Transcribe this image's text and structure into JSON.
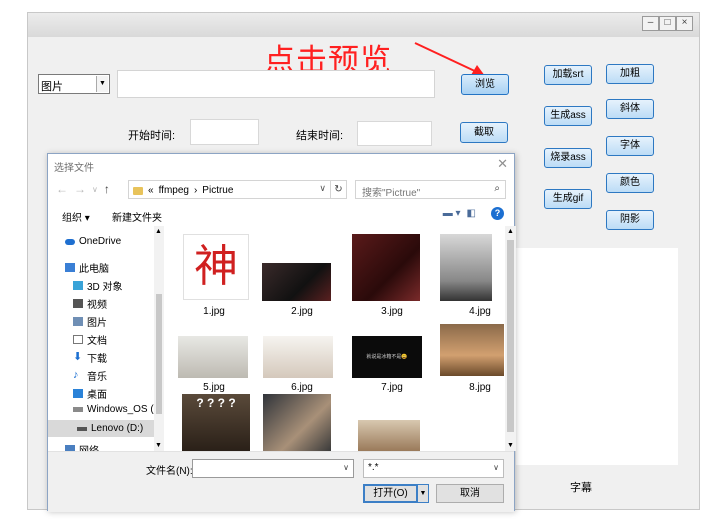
{
  "app": {
    "window_buttons": [
      "–",
      "□",
      "×"
    ],
    "annotation_text": "点击预览",
    "type_select_value": "图片",
    "path_value": "",
    "start_time_label": "开始时间:",
    "end_time_label": "结束时间:",
    "start_time_value": "",
    "end_time_value": "",
    "browse_label": "浏览",
    "capture_label": "截取",
    "buttons": {
      "load_srt": "加载srt",
      "generate_ass": "生成ass",
      "burn_ass": "烧录ass",
      "generate_gif": "生成gif",
      "bold": "加粗",
      "italic": "斜体",
      "font": "字体",
      "color": "颜色",
      "shadow": "阴影"
    },
    "subtitle_label": "字幕",
    "colors": {
      "accent_red": "#ff2020",
      "button_blue": "#bcdcf6"
    }
  },
  "dialog": {
    "title": "选择文件",
    "breadcrumb_prefix": "«",
    "breadcrumb": [
      "ffmpeg",
      "Pictrue"
    ],
    "search_placeholder": "搜索\"Pictrue\"",
    "organize_label": "组织 ▾",
    "new_folder_label": "新建文件夹",
    "sidebar": [
      {
        "label": "OneDrive",
        "icon": "cloud-icon"
      },
      {
        "label": "此电脑",
        "icon": "computer-icon"
      },
      {
        "label": "3D 对象",
        "icon": "cube-icon"
      },
      {
        "label": "视频",
        "icon": "video-icon"
      },
      {
        "label": "图片",
        "icon": "pictures-icon"
      },
      {
        "label": "文档",
        "icon": "document-icon"
      },
      {
        "label": "下载",
        "icon": "download-icon"
      },
      {
        "label": "音乐",
        "icon": "music-icon"
      },
      {
        "label": "桌面",
        "icon": "desktop-icon"
      },
      {
        "label": "Windows_OS (C",
        "icon": "drive-icon"
      },
      {
        "label": "Lenovo (D:)",
        "icon": "drive-icon"
      },
      {
        "label": "网络",
        "icon": "network-icon"
      }
    ],
    "files": [
      {
        "name": "1.jpg",
        "thumb_text": "神"
      },
      {
        "name": "2.jpg",
        "thumb_text": ""
      },
      {
        "name": "3.jpg",
        "thumb_text": ""
      },
      {
        "name": "4.jpg",
        "thumb_text": ""
      },
      {
        "name": "5.jpg",
        "thumb_text": ""
      },
      {
        "name": "6.jpg",
        "thumb_text": ""
      },
      {
        "name": "7.jpg",
        "thumb_text": "就说是冰箱不是😀"
      },
      {
        "name": "8.jpg",
        "thumb_text": ""
      },
      {
        "name": "",
        "thumb_text": "? ? ? ?"
      },
      {
        "name": "",
        "thumb_text": ""
      },
      {
        "name": "",
        "thumb_text": ""
      }
    ],
    "filename_label": "文件名(N):",
    "filename_value": "",
    "filetype_value": "*.*",
    "open_label": "打开(O)",
    "cancel_label": "取消"
  }
}
